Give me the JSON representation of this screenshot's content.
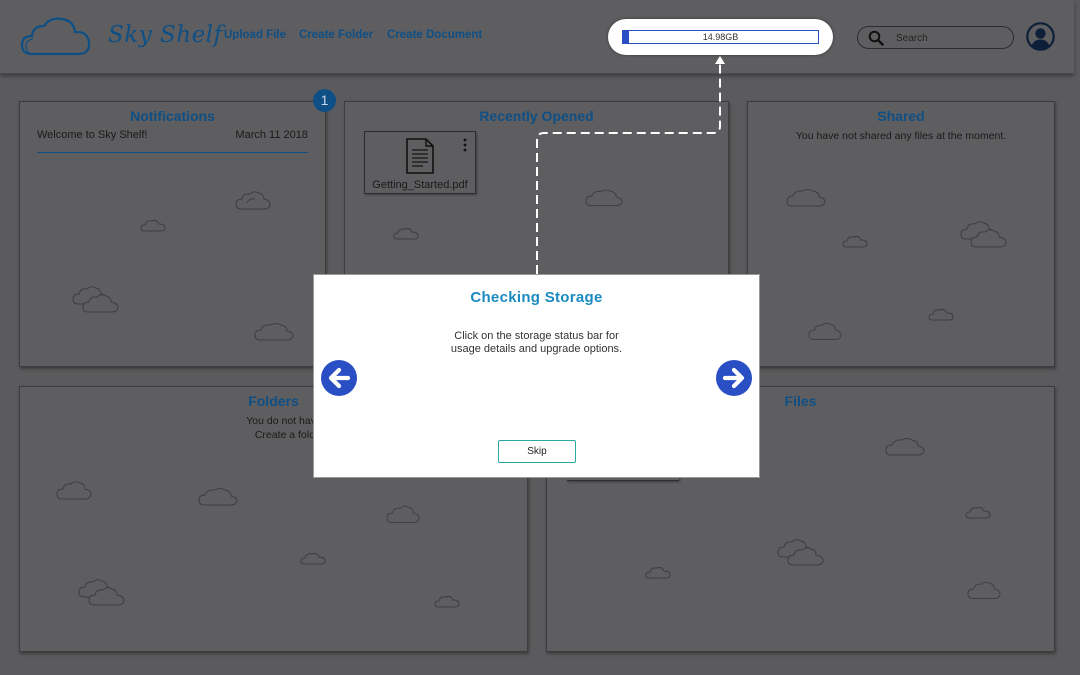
{
  "header": {
    "logo_text": "Sky Shelf",
    "nav": {
      "upload": "Upload File",
      "create_folder": "Create Folder",
      "create_document": "Create Document"
    },
    "storage": {
      "label": "14.98GB",
      "used_fraction": 0.03
    },
    "search_placeholder": "Search"
  },
  "notifications": {
    "title": "Notifications",
    "badge_count": "1",
    "items": [
      {
        "message": "Welcome to Sky Shelf!",
        "date": "March 11 2018"
      }
    ]
  },
  "recently_opened": {
    "title": "Recently Opened",
    "files": [
      {
        "name": "Getting_Started.pdf"
      }
    ]
  },
  "shared": {
    "title": "Shared",
    "empty_message": "You have not shared any files at the moment."
  },
  "folders": {
    "title": "Folders",
    "empty_line1": "You do not have any folders at",
    "empty_line2": "Create a folder to organize"
  },
  "files": {
    "title": "Files"
  },
  "tour": {
    "title": "Checking Storage",
    "body_line1": "Click on the storage status bar for",
    "body_line2": "usage details and upgrade options.",
    "skip_label": "Skip"
  },
  "colors": {
    "brand": "#0e4f85",
    "modal_title": "#1a8bc0",
    "storage_bar": "#2a4fc4",
    "arrow_button": "#2a4fc4",
    "skip_border": "#2ba8a0"
  },
  "icons": [
    "cloud-logo-icon",
    "search-icon",
    "user-avatar-icon",
    "document-icon",
    "kebab-menu-icon",
    "arrow-left-icon",
    "arrow-right-icon"
  ]
}
